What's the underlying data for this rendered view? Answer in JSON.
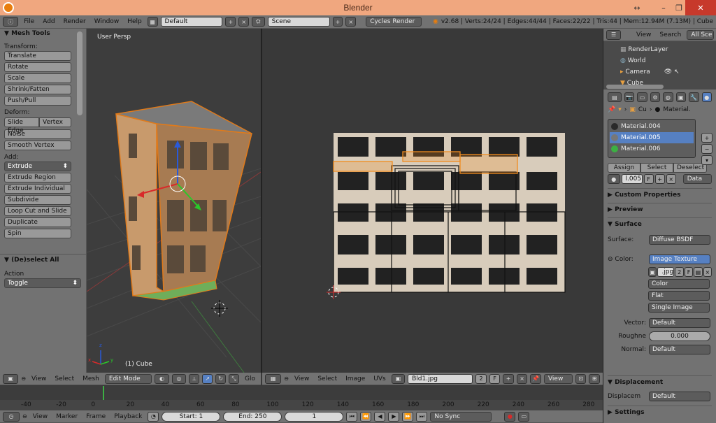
{
  "window": {
    "title": "Blender",
    "min": "–",
    "restore": "❐",
    "close": "✕",
    "move": "↔"
  },
  "topbar": {
    "menus": [
      "File",
      "Add",
      "Render",
      "Window",
      "Help"
    ],
    "layout": "Default",
    "scene": "Scene",
    "engine": "Cycles Render",
    "stats": "v2.68 | Verts:24/24 | Edges:44/44 | Faces:22/22 | Tris:44 | Mem:12.94M (7.13M) | Cube"
  },
  "toolshelf": {
    "header": "Mesh Tools",
    "transform_label": "Transform:",
    "transform": [
      "Translate",
      "Rotate",
      "Scale",
      "Shrink/Fatten",
      "Push/Pull"
    ],
    "deform_label": "Deform:",
    "deform_a": "Slide Edge",
    "deform_b": "Vertex",
    "deform": [
      "Noise",
      "Smooth Vertex"
    ],
    "add_label": "Add:",
    "add": [
      "Extrude",
      "Extrude Region",
      "Extrude Individual",
      "Subdivide",
      "Loop Cut and Slide",
      "Duplicate",
      "Spin"
    ],
    "op_header": "(De)select All",
    "action_label": "Action",
    "action_value": "Toggle"
  },
  "viewport": {
    "view_label": "User Persp",
    "object_label": "(1) Cube",
    "axis_x": "x",
    "axis_y": "y",
    "axis_z": "z"
  },
  "view3d_header": {
    "menus": [
      "View",
      "Select",
      "Mesh"
    ],
    "mode": "Edit Mode",
    "trunc": "Glo"
  },
  "image_header": {
    "menus": [
      "View",
      "Select",
      "Image",
      "UVs"
    ],
    "image": "Bld1.jpg",
    "users": "2",
    "fake": "F",
    "view": "View"
  },
  "outliner": {
    "view": "View",
    "search": "Search",
    "filter": "All Sce",
    "items": [
      "RenderLayer",
      "World",
      "Camera",
      "Cube"
    ]
  },
  "properties": {
    "crumb_obj": "Cu",
    "crumb_mat": "Material.",
    "materials": [
      {
        "name": "Material.004",
        "color": "#2a2a2a"
      },
      {
        "name": "Material.005",
        "color": "#777777"
      },
      {
        "name": "Material.006",
        "color": "#3cb043"
      }
    ],
    "assign": "Assign",
    "select": "Select",
    "deselect": "Deselect",
    "mat_name": "l.005",
    "mat_f": "F",
    "data": "Data",
    "custom_props": "Custom Properties",
    "preview": "Preview",
    "surface": "Surface",
    "surface_label": "Surface:",
    "surface_value": "Diffuse BSDF",
    "color_label": "Color:",
    "color_value": "Image Texture",
    "img_name": ".jpg",
    "img_users": "2",
    "img_f": "F",
    "color_space": "Color",
    "projection": "Flat",
    "source": "Single Image",
    "vector_label": "Vector:",
    "vector_value": "Default",
    "rough_label": "Roughne",
    "rough_value": "0.000",
    "normal_label": "Normal:",
    "normal_value": "Default",
    "displacement": "Displacement",
    "displace_label": "Displacem",
    "displace_value": "Default",
    "settings": "Settings"
  },
  "timeline": {
    "ticks": [
      "-40",
      "-20",
      "0",
      "20",
      "40",
      "60",
      "80",
      "100",
      "120",
      "140",
      "160",
      "180",
      "200",
      "220",
      "240",
      "260",
      "280"
    ],
    "menus": [
      "View",
      "Marker",
      "Frame",
      "Playback"
    ],
    "start": "Start: 1",
    "end": "End: 250",
    "current": "1",
    "sync": "No Sync"
  },
  "colors": {
    "accent": "#5680c2",
    "selection": "#f08c1e",
    "titlebar": "#f0a77f",
    "green": "#3cb043"
  }
}
